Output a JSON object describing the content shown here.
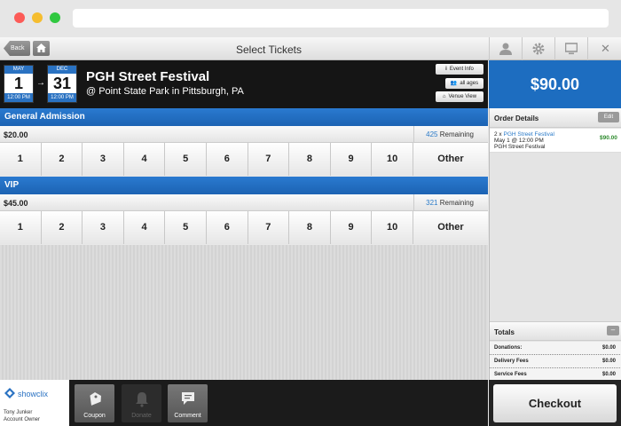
{
  "nav": {
    "back_label": "Back",
    "page_title": "Select Tickets"
  },
  "event": {
    "start": {
      "month": "MAY",
      "day": "1",
      "time": "12:00 PM"
    },
    "end": {
      "month": "DEC",
      "day": "31",
      "time": "12:00 PM"
    },
    "arrow": "→",
    "name": "PGH Street Festival",
    "venue": "@ Point State Park in Pittsburgh, PA",
    "buttons": {
      "info": "Event Info",
      "ages": "all ages",
      "venue": "Venue View"
    }
  },
  "order_total": "$90.00",
  "tiers": [
    {
      "name": "General Admission",
      "price": "$20.00",
      "remaining_count": "425",
      "remaining_label": "Remaining",
      "quantities": [
        "1",
        "2",
        "3",
        "4",
        "5",
        "6",
        "7",
        "8",
        "9",
        "10",
        "Other"
      ]
    },
    {
      "name": "VIP",
      "price": "$45.00",
      "remaining_count": "321",
      "remaining_label": "Remaining",
      "quantities": [
        "1",
        "2",
        "3",
        "4",
        "5",
        "6",
        "7",
        "8",
        "9",
        "10",
        "Other"
      ]
    }
  ],
  "order_details": {
    "title": "Order Details",
    "edit_label": "Edit",
    "item": {
      "qty_prefix": "2 x",
      "event_link": "PGH Street Festival",
      "datetime": "May 1 @ 12:00 PM",
      "venue": "PGH Street Festival",
      "price": "$90.00"
    }
  },
  "totals": {
    "title": "Totals",
    "collapse_label": "–",
    "rows": [
      {
        "label": "Donations:",
        "value": "$0.00"
      },
      {
        "label": "Delivery Fees",
        "value": "$0.00"
      },
      {
        "label": "Service Fees",
        "value": "$0.00"
      }
    ]
  },
  "footer": {
    "brand": "showclix",
    "user_name": "Tony Junker",
    "user_role": "Account Owner",
    "coupon_label": "Coupon",
    "donate_label": "Donate",
    "comment_label": "Comment"
  },
  "checkout_label": "Checkout",
  "colors": {
    "accent": "#1d6dc0",
    "link": "#2a7ac8",
    "price_green": "#2e8b2e"
  }
}
